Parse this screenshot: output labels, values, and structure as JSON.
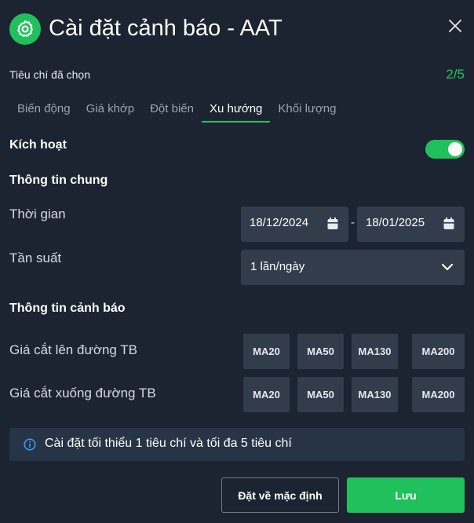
{
  "dialog": {
    "title": "Cài đặt cảnh báo - AAT",
    "logo_icon": "gear-icon",
    "close_icon": "close-icon"
  },
  "criteria": {
    "label": "Tiêu chí đã chọn",
    "count": "2/5"
  },
  "tabs": [
    {
      "label": "Biến động",
      "active": false
    },
    {
      "label": "Giá khớp",
      "active": false
    },
    {
      "label": "Đột biến",
      "active": false
    },
    {
      "label": "Xu hướng",
      "active": true
    },
    {
      "label": "Khối lượng",
      "active": false
    }
  ],
  "activate": {
    "label": "Kích hoạt",
    "enabled": true
  },
  "general": {
    "heading": "Thông tin chung",
    "time_label": "Thời gian",
    "date_from": "18/12/2024",
    "date_separator": "-",
    "date_to": "18/01/2025",
    "frequency_label": "Tần suất",
    "frequency_value": "1 lần/ngày"
  },
  "alert": {
    "heading": "Thông tin cảnh báo",
    "cross_up_label": "Giá cắt lên đường TB",
    "cross_down_label": "Giá cắt xuống đường TB",
    "ma_options": [
      "MA20",
      "MA50",
      "MA130",
      "MA200"
    ]
  },
  "info": {
    "text": "Cài đặt tối thiểu 1 tiêu chí và tối đa 5 tiêu chí"
  },
  "actions": {
    "reset_label": "Đặt về mặc định",
    "save_label": "Lưu"
  },
  "colors": {
    "accent": "#20c05c",
    "background": "#1c2431",
    "field": "#333c4a",
    "info_background": "#263446"
  }
}
